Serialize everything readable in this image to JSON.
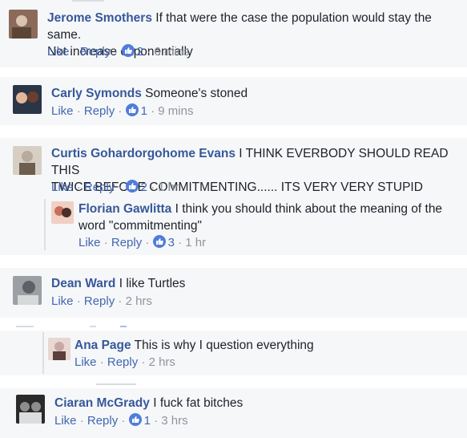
{
  "comments": [
    {
      "author": "Jerome Smothers",
      "text_line1": "If that were the case the population would stay the same.",
      "text_line2": "Not increase exponentially",
      "like": "Like",
      "reply": "Reply",
      "reactions": "2",
      "time": "6 mins",
      "avatar_colors": [
        "#8c6a5a",
        "#d9c4b2",
        "#5b4636"
      ]
    },
    {
      "author": "Carly Symonds",
      "text_line1": "Someone's stoned",
      "like": "Like",
      "reply": "Reply",
      "reactions": "1",
      "time": "9 mins",
      "avatar_colors": [
        "#2b3548",
        "#e3b79c",
        "#6b3f2c"
      ]
    },
    {
      "author": "Curtis Gohardorgohome Evans",
      "text_line1": "I THINK EVERBODY SHOULD READ THIS",
      "text_line2": "TWICE BEFORE COMMITMENTING...... ITS VERY VERY STUPID",
      "like": "Like",
      "reply": "Reply",
      "reactions": "2",
      "time": "1 hr",
      "avatar_colors": [
        "#b7ab9d",
        "#d8cfc4",
        "#6d5e4f"
      ],
      "reply_item": {
        "author": "Florian Gawlitta",
        "text_line1": "I think you should think about the meaning of the",
        "text_line2": "word \"commitmenting\"",
        "like": "Like",
        "reply": "Reply",
        "reactions": "3",
        "time": "1 hr",
        "avatar_colors": [
          "#c96d5c",
          "#f0d0c4",
          "#4a2e2a"
        ]
      }
    },
    {
      "author": "Dean Ward",
      "text_line1": "I like Turtles",
      "like": "Like",
      "reply": "Reply",
      "time": "2 hrs",
      "avatar_colors": [
        "#9c9fa3",
        "#5d6166",
        "#d6d8da"
      ],
      "reply_item": {
        "author": "Ana Page",
        "text_line1": "This is why I question everything",
        "like": "Like",
        "reply": "Reply",
        "time": "2 hrs",
        "avatar_colors": [
          "#c8a8a4",
          "#5a3f3c",
          "#e8d7d3"
        ]
      }
    },
    {
      "author": "Ciaran McGrady",
      "text_line1": "I fuck fat bitches",
      "like": "Like",
      "reply": "Reply",
      "reactions": "1",
      "time": "3 hrs",
      "avatar_colors": [
        "#2a2a2a",
        "#8d8d8d",
        "#dcdcdc"
      ]
    }
  ],
  "colors": {
    "link": "#365899",
    "action": "#4267b2",
    "meta": "#90949c",
    "card_bg": "#f6f7f9",
    "like_badge": "#4f7ddb"
  }
}
